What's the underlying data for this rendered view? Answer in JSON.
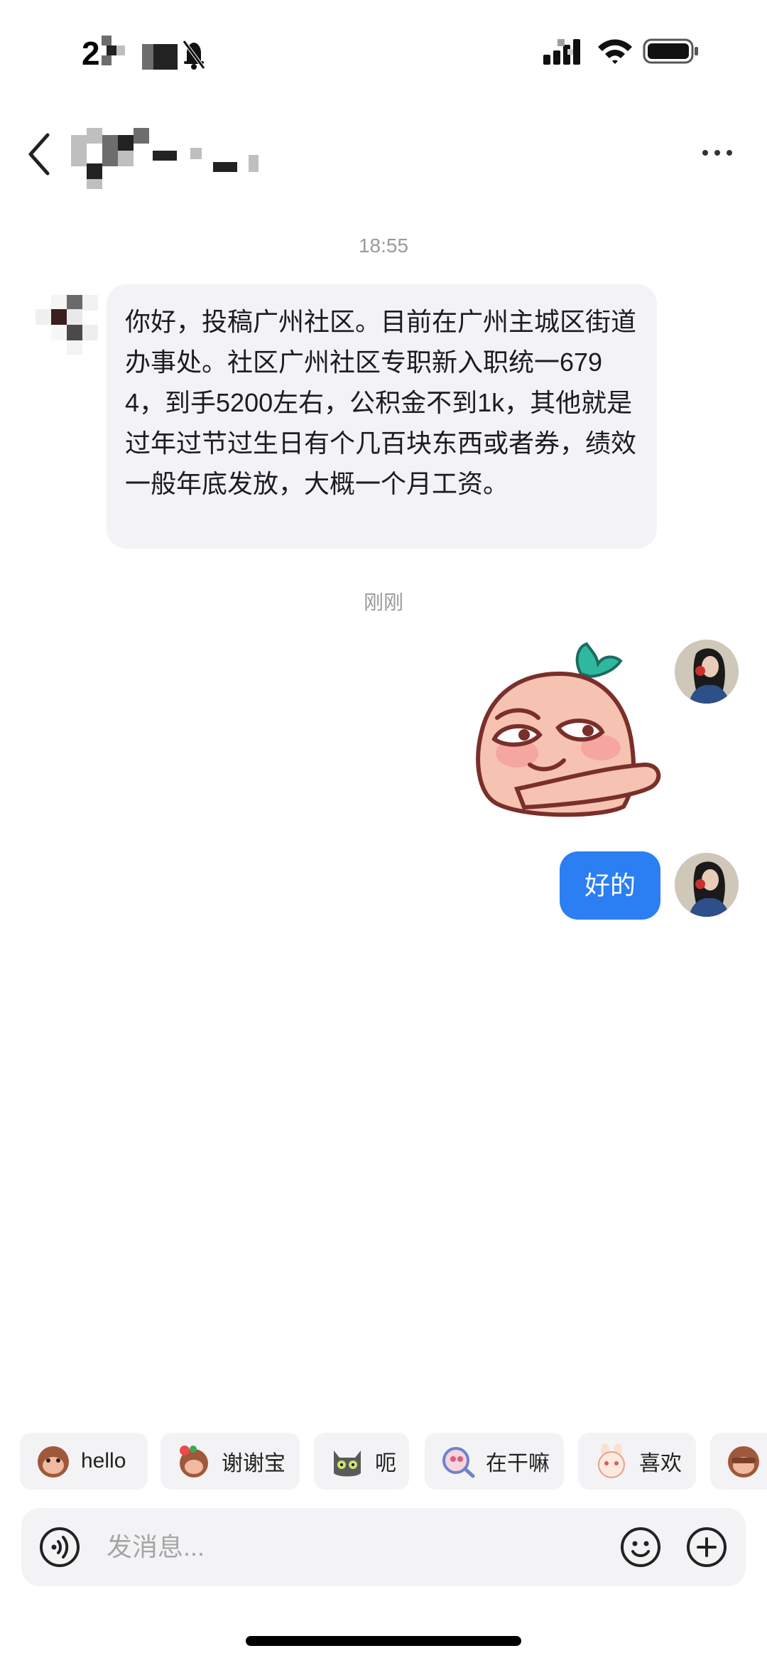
{
  "status_bar": {
    "time": "2"
  },
  "chat": {
    "timestamp_1": "18:55",
    "incoming_message": "你好，投稿广州社区。目前在广州主城区街道办事处。社区广州社区专职新入职统一6794，到手5200左右，公积金不到1k，其他就是过年过节过生日有个几百块东西或者券，绩效一般年底发放，大概一个月工资。",
    "timestamp_2": "刚刚",
    "outgoing_message": "好的"
  },
  "quick_replies": [
    {
      "label": "hello",
      "icon": "monkey-sticker-icon"
    },
    {
      "label": "谢谢宝",
      "icon": "monkey-flower-sticker-icon"
    },
    {
      "label": "呃",
      "icon": "cat-sticker-icon"
    },
    {
      "label": "在干嘛",
      "icon": "magnifier-sticker-icon"
    },
    {
      "label": "喜欢",
      "icon": "bunny-sticker-icon"
    },
    {
      "label": "",
      "icon": "monkey-sticker-icon"
    }
  ],
  "input": {
    "placeholder": "发消息..."
  },
  "colors": {
    "outgoing_bubble": "#2b7ff3",
    "incoming_bubble": "#f3f3f5",
    "sticker_teal": "#2fb8a0"
  }
}
